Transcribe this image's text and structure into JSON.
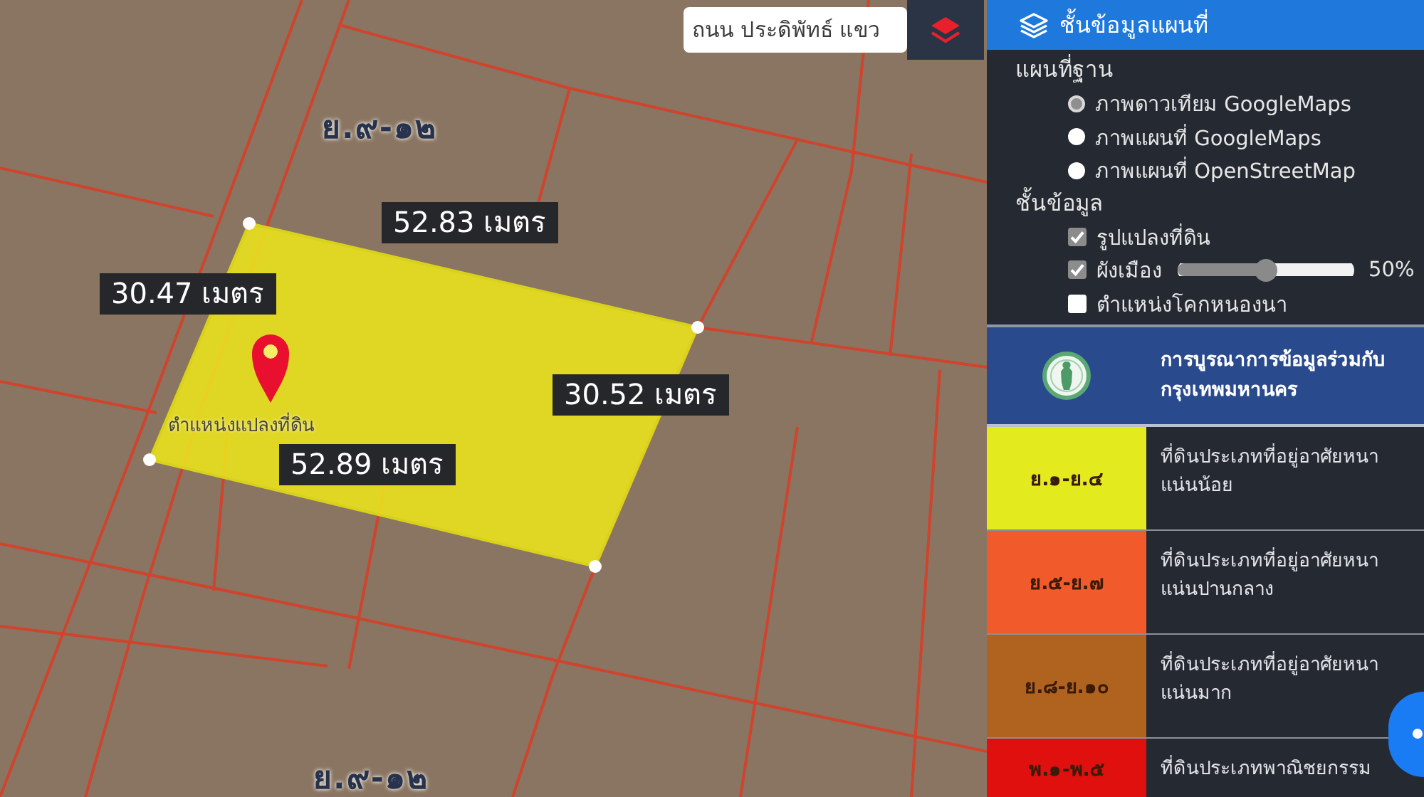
{
  "map": {
    "search": {
      "value": "ถนน ประดิพัทธ์ แขว"
    },
    "zone_labels": [
      "ย.๙-๑๒",
      "ย.๙-๑๒"
    ],
    "distance_labels": [
      "52.83 เมตร",
      "30.47 เมตร",
      "30.52 เมตร",
      "52.89 เมตร"
    ],
    "pin_label": "ตำแหน่งแปลงที่ดิน"
  },
  "layer_panel": {
    "title": "ชั้นข้อมูลแผนที่",
    "base_map": {
      "heading": "แผนที่ฐาน",
      "options": [
        {
          "label": "ภาพดาวเทียม GoogleMaps",
          "selected": true
        },
        {
          "label": "ภาพแผนที่ GoogleMaps",
          "selected": false
        },
        {
          "label": "ภาพแผนที่ OpenStreetMap",
          "selected": false
        }
      ]
    },
    "data_layers": {
      "heading": "ชั้นข้อมูล",
      "items": [
        {
          "kind": "checkbox",
          "label": "รูปแปลงที่ดิน",
          "checked": true
        },
        {
          "kind": "slider",
          "label": "ผังเมือง",
          "checked": true,
          "level": 0.5,
          "reading": "50%"
        },
        {
          "kind": "checkbox",
          "label": "ตำแหน่งโคกหนองนา",
          "checked": false
        }
      ]
    }
  },
  "legend": {
    "title": "การบูรณาการข้อมูลร่วมกับ กรุงเทพมหานคร",
    "rows": [
      {
        "code": "ย.๑-ย.๔",
        "description": "ที่ดินประเภทที่อยู่อาศัยหนาแน่นน้อย",
        "color": "#e3ea1e"
      },
      {
        "code": "ย.๕-ย.๗",
        "description": "ที่ดินประเภทที่อยู่อาศัยหนาแน่นปานกลาง",
        "color": "#f15a2a"
      },
      {
        "code": "ย.๘-ย.๑๐",
        "description": "ที่ดินประเภทที่อยู่อาศัยหนาแน่นมาก",
        "color": "#b0631f"
      },
      {
        "code": "พ.๑-พ.๕",
        "description": "ที่ดินประเภทพาณิชยกรรม",
        "color": "#e0100f"
      }
    ]
  }
}
